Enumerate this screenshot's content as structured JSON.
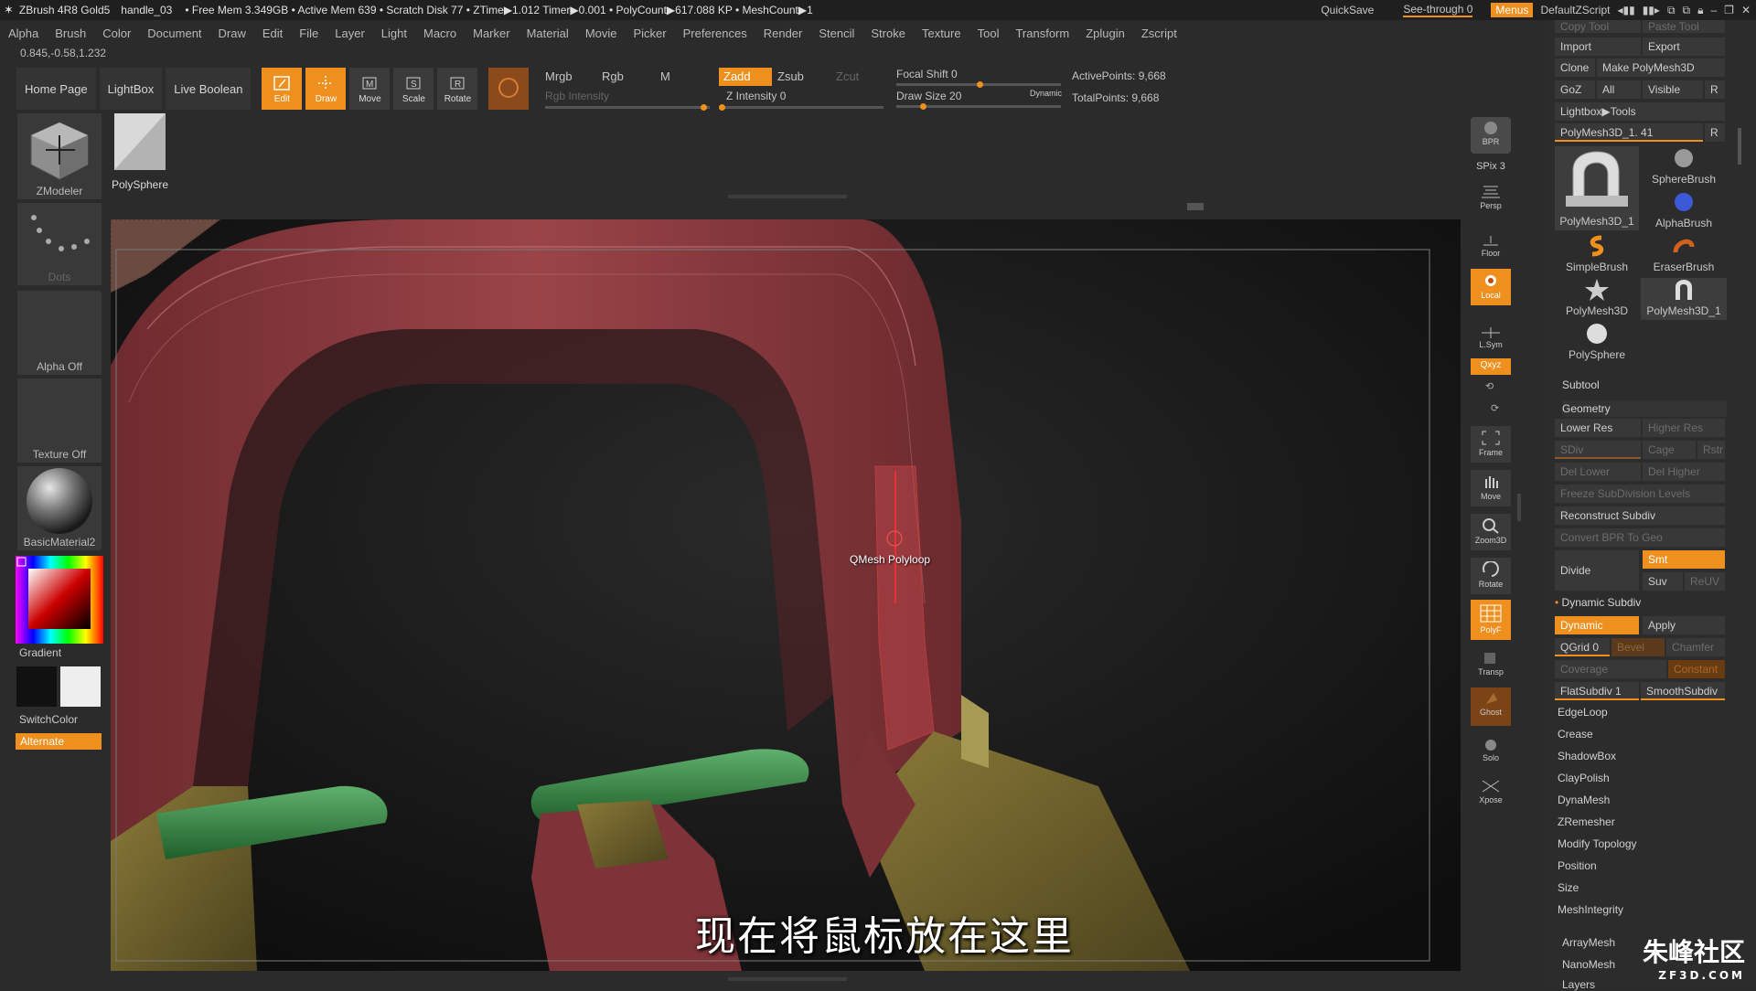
{
  "title": {
    "app": "ZBrush 4R8 Gold5",
    "document": "handle_03",
    "status": "• Free Mem 3.349GB • Active Mem 639 • Scratch Disk 77 • ZTime▶1.012 Timer▶0.001 • PolyCount▶617.088 KP • MeshCount▶1",
    "quicksave": "QuickSave",
    "seethrough": "See-through  0",
    "menus": "Menus",
    "script": "DefaultZScript"
  },
  "menu": [
    "Alpha",
    "Brush",
    "Color",
    "Document",
    "Draw",
    "Edit",
    "File",
    "Layer",
    "Light",
    "Macro",
    "Marker",
    "Material",
    "Movie",
    "Picker",
    "Preferences",
    "Render",
    "Stencil",
    "Stroke",
    "Texture",
    "Tool",
    "Transform",
    "Zplugin",
    "Zscript"
  ],
  "coords": "0.845,-0.58,1.232",
  "toolbar": {
    "home": "Home Page",
    "lightbox": "LightBox",
    "live_boolean": "Live Boolean",
    "edit": "Edit",
    "draw": "Draw",
    "move": "Move",
    "scale": "Scale",
    "rotate": "Rotate",
    "mrgb": "Mrgb",
    "rgb": "Rgb",
    "m": "M",
    "rgb_intensity": "Rgb Intensity",
    "zadd": "Zadd",
    "zsub": "Zsub",
    "zcut": "Zcut",
    "z_intensity": "Z Intensity 0",
    "focal_shift": "Focal Shift 0",
    "draw_size": "Draw Size 20",
    "dynamic": "Dynamic",
    "active_points": "ActivePoints: 9,668",
    "total_points": "TotalPoints: 9,668"
  },
  "left": {
    "zmodeler": "ZModeler",
    "polysphere": "PolySphere",
    "dots": "Dots",
    "alpha_off": "Alpha Off",
    "texture_off": "Texture Off",
    "material": "BasicMaterial2",
    "gradient": "Gradient",
    "switchcolor": "SwitchColor",
    "alternate": "Alternate"
  },
  "vstrip": [
    {
      "name": "bpr",
      "label": "BPR"
    },
    {
      "name": "spix",
      "label": "SPix 3"
    },
    {
      "name": "persp",
      "label": "Persp"
    },
    {
      "name": "floor",
      "label": "Floor"
    },
    {
      "name": "local",
      "label": "Local"
    },
    {
      "name": "lsym",
      "label": "L.Sym"
    },
    {
      "name": "xyz",
      "label": "Qxyz"
    },
    {
      "name": "frame",
      "label": "Frame"
    },
    {
      "name": "move",
      "label": "Move"
    },
    {
      "name": "zoom3d",
      "label": "Zoom3D"
    },
    {
      "name": "rotate",
      "label": "Rotate"
    },
    {
      "name": "polyf",
      "label": "PolyF"
    },
    {
      "name": "transp",
      "label": "Transp"
    },
    {
      "name": "ghost",
      "label": "Ghost"
    },
    {
      "name": "solo",
      "label": "Solo"
    },
    {
      "name": "xpose",
      "label": "Xpose"
    }
  ],
  "viewport": {
    "cursor_label": "QMesh Polyloop",
    "subtitle": "现在将鼠标放在这里"
  },
  "rpanel": {
    "copy_tool": "Copy Tool",
    "paste_tool": "Paste Tool",
    "import": "Import",
    "export": "Export",
    "clone": "Clone",
    "make_polymesh": "Make PolyMesh3D",
    "goz": "GoZ",
    "all": "All",
    "visible": "Visible",
    "r": "R",
    "lightbox_tools": "Lightbox▶Tools",
    "current_tool": "PolyMesh3D_1. 41",
    "tools": [
      {
        "name": "polymesh3d_1",
        "label": "PolyMesh3D_1"
      },
      {
        "name": "spherebrush",
        "label": "SphereBrush"
      },
      {
        "name": "alphabrush",
        "label": "AlphaBrush"
      },
      {
        "name": "simplebrush",
        "label": "SimpleBrush"
      },
      {
        "name": "eraserbrush",
        "label": "EraserBrush"
      },
      {
        "name": "polymesh3d",
        "label": "PolyMesh3D"
      },
      {
        "name": "polymesh3d_1b",
        "label": "PolyMesh3D_1"
      },
      {
        "name": "polysphere",
        "label": "PolySphere"
      }
    ],
    "subtool": "Subtool",
    "geometry": "Geometry",
    "lower_res": "Lower Res",
    "higher_res": "Higher Res",
    "sdiv": "SDiv",
    "cage": "Cage",
    "rstr": "Rstr",
    "del_lower": "Del Lower",
    "del_higher": "Del Higher",
    "freeze": "Freeze SubDivision Levels",
    "reconstruct": "Reconstruct Subdiv",
    "convert_bpr": "Convert BPR To Geo",
    "divide": "Divide",
    "smt": "Smt",
    "suv": "Suv",
    "reuv": "ReUV",
    "dynamic_subdiv": "Dynamic Subdiv",
    "dynamic": "Dynamic",
    "apply": "Apply",
    "qgrid": "QGrid 0",
    "bevel": "Bevel",
    "chamfer": "Chamfer",
    "coverage": "Coverage",
    "constant": "Constant",
    "flatsubdiv": "FlatSubdiv 1",
    "smoothsubdiv": "SmoothSubdiv",
    "items": [
      "EdgeLoop",
      "Crease",
      "ShadowBox",
      "ClayPolish",
      "DynaMesh",
      "ZRemesher",
      "Modify Topology",
      "Position",
      "Size",
      "MeshIntegrity",
      "ArrayMesh",
      "NanoMesh",
      "Layers"
    ]
  },
  "watermark": {
    "main": "朱峰社区",
    "sub": "ZF3D.COM"
  }
}
